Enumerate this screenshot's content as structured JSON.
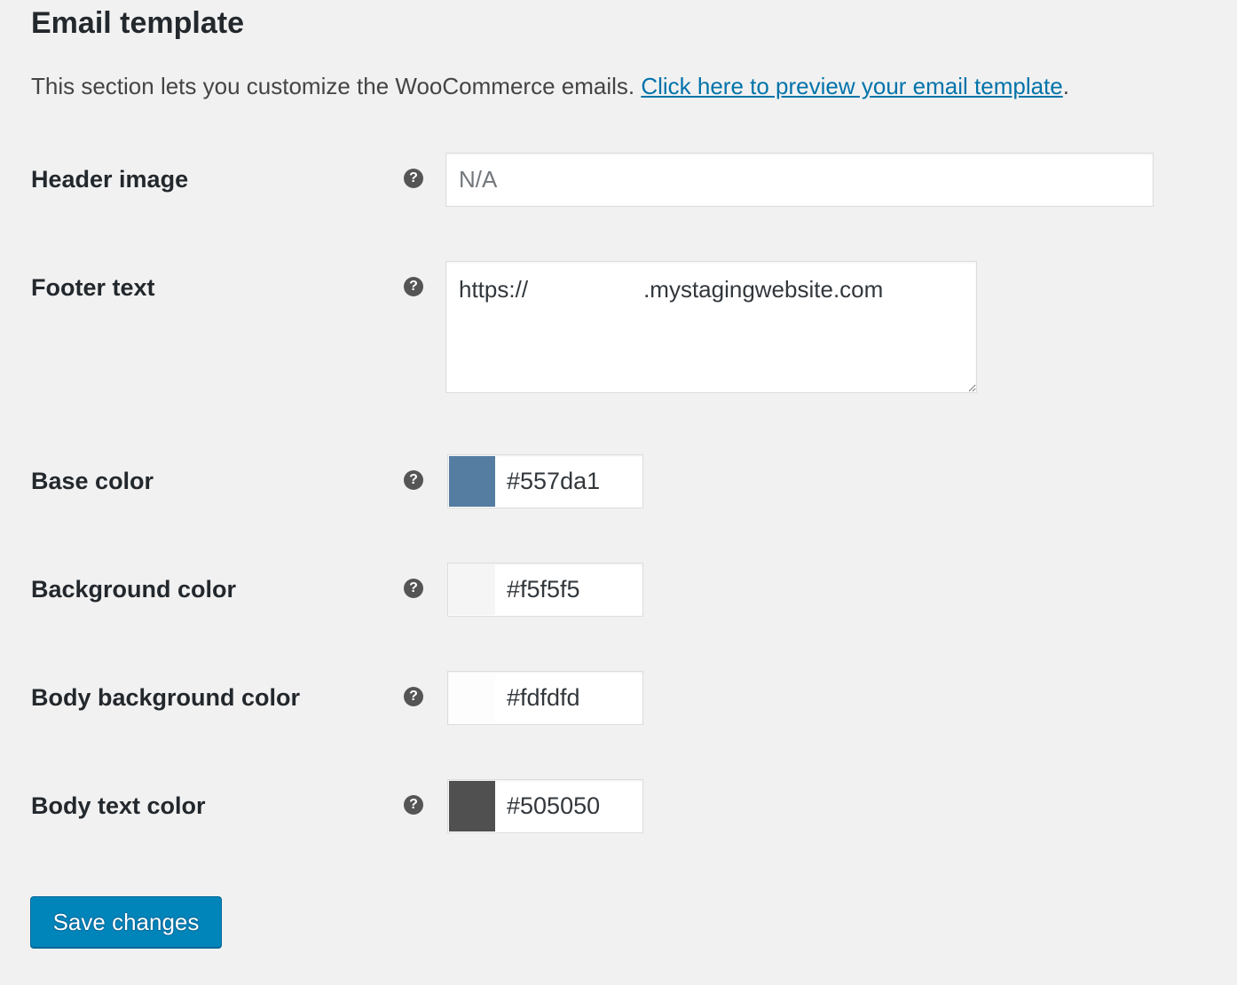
{
  "section": {
    "title": "Email template",
    "intro_text": "This section lets you customize the WooCommerce emails. ",
    "preview_link": "Click here to preview your email template",
    "intro_end": "."
  },
  "fields": {
    "header_image": {
      "label": "Header image",
      "placeholder": "N/A",
      "value": ""
    },
    "footer_text": {
      "label": "Footer text",
      "value": "https://                  .mystagingwebsite.com"
    },
    "base_color": {
      "label": "Base color",
      "value": "#557da1",
      "swatch": "#557da1"
    },
    "background_color": {
      "label": "Background color",
      "value": "#f5f5f5",
      "swatch": "#f5f5f5"
    },
    "body_background_color": {
      "label": "Body background color",
      "value": "#fdfdfd",
      "swatch": "#fdfdfd"
    },
    "body_text_color": {
      "label": "Body text color",
      "value": "#505050",
      "swatch": "#505050"
    }
  },
  "help_icon": {
    "name": "question-circle-icon",
    "glyph": "?"
  },
  "save_button": {
    "label": "Save changes"
  },
  "colors": {
    "link": "#0073aa",
    "primary_button": "#0085ba",
    "page_background": "#f1f1f1"
  }
}
